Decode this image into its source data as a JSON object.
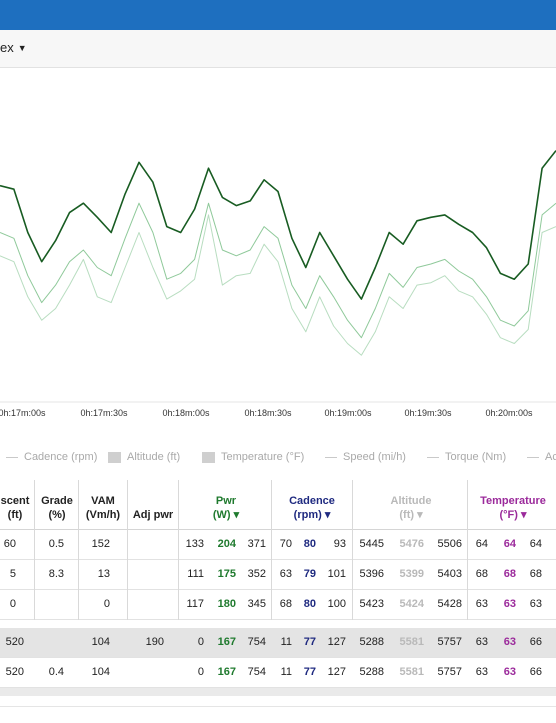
{
  "toolbar": {
    "dropdown_label": "ex"
  },
  "colors": {
    "topbar": "#1e6fbf",
    "power": "#1f7a2e",
    "cadence": "#1f2a80",
    "altitude": "#b9b9b9",
    "temperature": "#9b2a9b",
    "line_dark": "#185c22",
    "line_mid": "#8fc99a",
    "line_light": "#b8ddc0"
  },
  "chart_data": {
    "type": "line",
    "x_ticks": [
      "0h:17m:00s",
      "0h:17m:30s",
      "0h:18m:00s",
      "0h:18m:30s",
      "0h:19m:00s",
      "0h:19m:30s",
      "0h:20m:00s"
    ],
    "x": [
      0,
      5,
      10,
      15,
      20,
      25,
      30,
      35,
      40,
      45,
      50,
      55,
      60,
      65,
      70,
      75,
      80,
      85,
      90,
      95,
      100,
      105,
      110,
      115,
      120,
      125,
      130,
      135,
      140,
      145,
      150,
      155,
      160,
      165,
      170,
      175,
      180,
      185,
      190,
      195,
      200
    ],
    "series": [
      {
        "values": [
          245,
          242,
          205,
          180,
          198,
          222,
          230,
          218,
          205,
          238,
          265,
          248,
          210,
          205,
          225,
          260,
          235,
          228,
          232,
          250,
          240,
          200,
          175,
          205,
          185,
          165,
          148,
          175,
          205,
          195,
          215,
          218,
          220,
          212,
          205,
          192,
          170,
          165,
          178,
          260,
          275
        ]
      },
      {
        "values": [
          205,
          200,
          168,
          145,
          160,
          180,
          190,
          175,
          168,
          200,
          230,
          205,
          165,
          170,
          182,
          230,
          190,
          185,
          190,
          210,
          200,
          160,
          140,
          168,
          150,
          130,
          115,
          140,
          170,
          158,
          175,
          178,
          182,
          172,
          165,
          150,
          130,
          125,
          138,
          220,
          230
        ]
      },
      {
        "values": [
          185,
          180,
          150,
          130,
          140,
          160,
          182,
          150,
          145,
          175,
          205,
          175,
          148,
          155,
          165,
          220,
          160,
          168,
          170,
          195,
          180,
          140,
          120,
          150,
          125,
          110,
          100,
          120,
          150,
          140,
          160,
          162,
          168,
          155,
          150,
          135,
          115,
          110,
          122,
          205,
          210
        ]
      }
    ],
    "ylim": [
      60,
      320
    ],
    "grid": false,
    "legend": "bottom"
  },
  "legend": {
    "items": [
      {
        "label": "Cadence (rpm)",
        "kind": "line"
      },
      {
        "label": "Altitude (ft)",
        "kind": "box"
      },
      {
        "label": "Temperature (°F)",
        "kind": "box"
      },
      {
        "label": "Speed (mi/h)",
        "kind": "line"
      },
      {
        "label": "Torque (Nm)",
        "kind": "line"
      },
      {
        "label": "Ac",
        "kind": "line"
      }
    ]
  },
  "table": {
    "headers": {
      "ascent": {
        "title": "scent",
        "unit": "(ft)"
      },
      "grade": {
        "title": "Grade",
        "unit": "(%)"
      },
      "vam": {
        "title": "VAM",
        "unit": "(Vm/h)"
      },
      "adjpwr": {
        "title": "Adj pwr"
      },
      "pwr": {
        "title": "Pwr",
        "unit": "(W) ▾"
      },
      "cadence": {
        "title": "Cadence",
        "unit": "(rpm) ▾"
      },
      "altitude": {
        "title": "Altitude",
        "unit": "(ft) ▾"
      },
      "temperature": {
        "title": "Temperature",
        "unit": "(°F) ▾"
      }
    },
    "rows": [
      {
        "ascent": "60",
        "grade": "0.5",
        "vam": "152",
        "adjpwr": "",
        "pwr": [
          "133",
          "204",
          "371"
        ],
        "cad": [
          "70",
          "80",
          "93"
        ],
        "alt": [
          "5445",
          "5476",
          "5506"
        ],
        "temp": [
          "64",
          "64",
          "64"
        ]
      },
      {
        "ascent": "5",
        "grade": "8.3",
        "vam": "13",
        "adjpwr": "",
        "pwr": [
          "111",
          "175",
          "352"
        ],
        "cad": [
          "63",
          "79",
          "101"
        ],
        "alt": [
          "5396",
          "5399",
          "5403"
        ],
        "temp": [
          "68",
          "68",
          "68"
        ]
      },
      {
        "ascent": "0",
        "grade": "",
        "vam": "0",
        "adjpwr": "",
        "pwr": [
          "117",
          "180",
          "345"
        ],
        "cad": [
          "68",
          "80",
          "100"
        ],
        "alt": [
          "5423",
          "5424",
          "5428"
        ],
        "temp": [
          "63",
          "63",
          "63"
        ]
      },
      {
        "ascent": "520",
        "grade": "",
        "vam": "104",
        "adjpwr": "190",
        "pwr": [
          "0",
          "167",
          "754"
        ],
        "cad": [
          "11",
          "77",
          "127"
        ],
        "alt": [
          "5288",
          "5581",
          "5757"
        ],
        "temp": [
          "63",
          "63",
          "66"
        ]
      },
      {
        "ascent": "520",
        "grade": "0.4",
        "vam": "104",
        "adjpwr": "",
        "pwr": [
          "0",
          "167",
          "754"
        ],
        "cad": [
          "11",
          "77",
          "127"
        ],
        "alt": [
          "5288",
          "5581",
          "5757"
        ],
        "temp": [
          "63",
          "63",
          "66"
        ]
      }
    ]
  }
}
